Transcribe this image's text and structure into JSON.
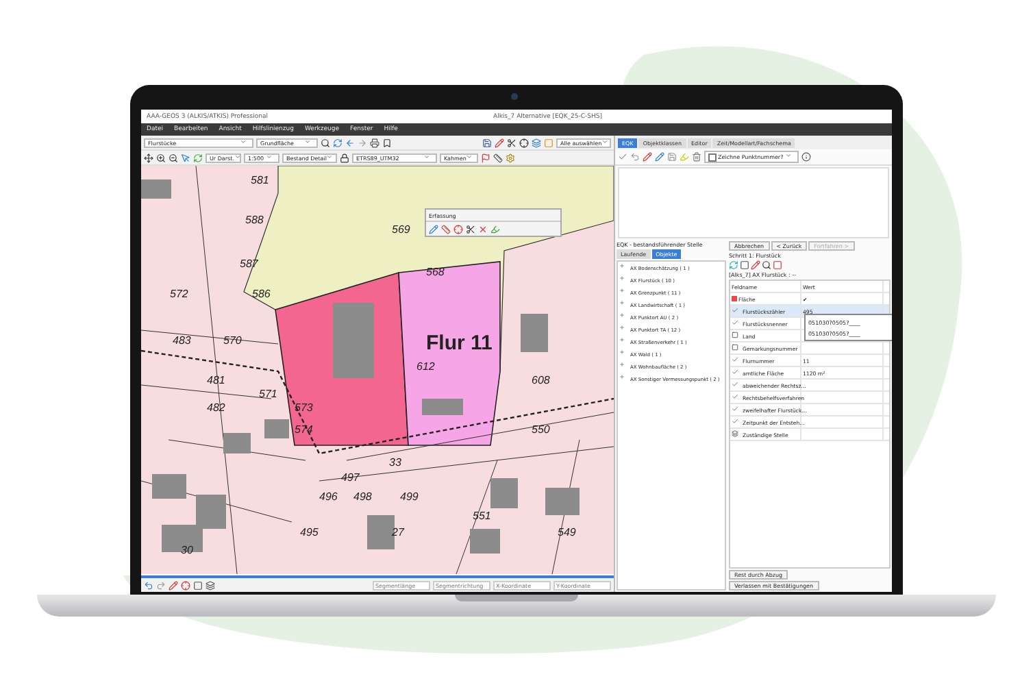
{
  "window": {
    "app_title": "AAA-GEOS 3 (ALKIS/ATKIS) Professional",
    "document_title": "Alkis_7 Alternative [EQK_25-C-SHS]"
  },
  "menu": [
    "Datei",
    "Bearbeiten",
    "Ansicht",
    "Hilfslinienzug",
    "Werkzeuge",
    "Fenster",
    "Hilfe"
  ],
  "toolbar": {
    "layer_select": "Flurstücke",
    "class_select": "Grundfläche",
    "selection_select": "Alle auswählen",
    "display_select": "Ur Darst.",
    "scale_select": "1:500",
    "style_select": "Bestand Detail",
    "crs_select": "ETRS89_UTM32",
    "mode_select": "Kahmen"
  },
  "map": {
    "parcel_label": "Flur 11",
    "labels": [
      "581",
      "588",
      "569",
      "587",
      "568",
      "572",
      "586",
      "483",
      "570",
      "612",
      "481",
      "608",
      "571",
      "482",
      "573",
      "574",
      "550",
      "33",
      "497",
      "496",
      "498",
      "499",
      "551",
      "495",
      "27",
      "549",
      "30"
    ]
  },
  "floating_toolbar": {
    "title": "Erfassung"
  },
  "status_fields": [
    {
      "placeholder": "Segmentlänge"
    },
    {
      "placeholder": "Segmentrichtung"
    },
    {
      "placeholder": "X-Koordinate"
    },
    {
      "placeholder": "Y-Koordinate"
    }
  ],
  "right_tabs": [
    {
      "label": "EQK",
      "selected": true
    },
    {
      "label": "Objektklassen",
      "selected": false
    },
    {
      "label": "Editor",
      "selected": false
    },
    {
      "label": "Zeit/Modellart/Fachschema",
      "selected": false
    }
  ],
  "edit_toolbar": {
    "checkbox_label": "Zeichne Punktnummer?",
    "checked": false
  },
  "tree_panel": {
    "title": "EQK - bestandsführender Stelle",
    "tabs": [
      {
        "label": "Laufende",
        "selected": false
      },
      {
        "label": "Objekte",
        "selected": true
      }
    ],
    "items": [
      "AX Bodenschätzung ( 1 )",
      "AX Flurstück ( 10 )",
      "AX Grenzpunkt ( 11 )",
      "AX Landwirtschaft ( 1 )",
      "AX Punktort AU ( 2 )",
      "AX Punktort TA ( 12 )",
      "AX Straßenverkehr ( 1 )",
      "AX Wald ( 1 )",
      "AX Wohnbaufläche ( 2 )",
      "AX Sonstiger Vermessungspunkt ( 2 )"
    ]
  },
  "wizard": {
    "buttons": [
      {
        "label": "Abbrechen",
        "disabled": false
      },
      {
        "label": "< Zurück",
        "disabled": false
      },
      {
        "label": "Fortfahren >",
        "disabled": true
      }
    ],
    "step": "Schritt 1: Flurstück",
    "object": "[Alks_7] AX Flurstück : --",
    "columns": [
      "Feldname",
      "Wert"
    ],
    "rows": [
      {
        "kind": "color",
        "name": "Fläche",
        "value": "✔",
        "selected": false
      },
      {
        "kind": "check",
        "name": "Flurstückszähler",
        "value": "495",
        "selected": true
      },
      {
        "kind": "check",
        "name": "Flurstücksnenner",
        "value": "",
        "selected": false
      },
      {
        "kind": "book",
        "name": "Land",
        "value": "",
        "selected": false
      },
      {
        "kind": "book",
        "name": "Gemarkungsnummer",
        "value": "",
        "selected": false
      },
      {
        "kind": "check",
        "name": "Flurnummer",
        "value": "11",
        "selected": false
      },
      {
        "kind": "check",
        "name": "amtliche Fläche",
        "value": "1120 m²",
        "selected": false
      },
      {
        "kind": "check",
        "name": "abweichender Rechtsz...",
        "value": "",
        "selected": false
      },
      {
        "kind": "check",
        "name": "Rechtsbehelfsverfahren",
        "value": "",
        "selected": false
      },
      {
        "kind": "check",
        "name": "zweifelhafter Flurstück...",
        "value": "",
        "selected": false
      },
      {
        "kind": "check",
        "name": "Zeitpunkt der Entsteh...",
        "value": "",
        "selected": false
      },
      {
        "kind": "people",
        "name": "Zuständige Stelle",
        "value": "",
        "selected": false
      }
    ],
    "dropdown_options": [
      "051030?0505?____",
      "051030?0505?____"
    ],
    "footer_buttons": [
      "Rest durch Abzug",
      "Verlassen mit Bestätigungen"
    ]
  }
}
